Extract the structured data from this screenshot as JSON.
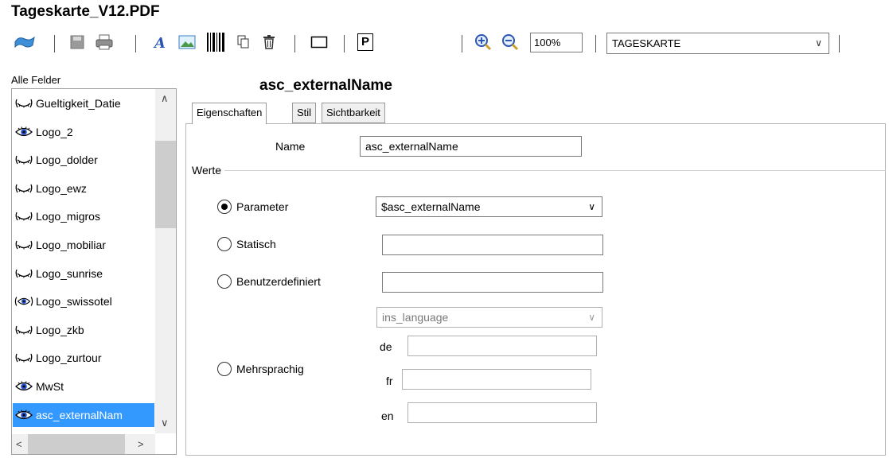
{
  "window": {
    "title": "Tageskarte_V12.PDF"
  },
  "toolbar": {
    "zoom_value": "100%",
    "view_select": "TAGESKARTE",
    "p_label": "P",
    "icons": [
      "back-arrow-icon",
      "save-icon",
      "print-icon",
      "text-field-icon",
      "image-icon",
      "barcode-icon",
      "copy-icon",
      "delete-icon",
      "rectangle-icon",
      "parameter-icon",
      "zoom-in-icon",
      "zoom-out-icon",
      "chevron-down-icon"
    ]
  },
  "sidebar": {
    "label": "Alle Felder",
    "items": [
      {
        "label": "Gueltigkeit_Datie",
        "icon": "hidden-eye-icon"
      },
      {
        "label": "Logo_2",
        "icon": "eye-icon"
      },
      {
        "label": "Logo_dolder",
        "icon": "hidden-eye-icon"
      },
      {
        "label": "Logo_ewz",
        "icon": "hidden-eye-icon"
      },
      {
        "label": "Logo_migros",
        "icon": "hidden-eye-icon"
      },
      {
        "label": "Logo_mobiliar",
        "icon": "hidden-eye-icon"
      },
      {
        "label": "Logo_sunrise",
        "icon": "hidden-eye-icon"
      },
      {
        "label": "Logo_swissotel",
        "icon": "conditional-eye-icon"
      },
      {
        "label": "Logo_zkb",
        "icon": "hidden-eye-icon"
      },
      {
        "label": "Logo_zurtour",
        "icon": "hidden-eye-icon"
      },
      {
        "label": "MwSt",
        "icon": "eye-icon"
      },
      {
        "label": "asc_externalNam",
        "icon": "eye-icon",
        "selected": true
      }
    ]
  },
  "main": {
    "heading": "asc_externalName",
    "tabs": [
      {
        "label": "Eigenschaften",
        "active": true
      },
      {
        "label": "Stil"
      },
      {
        "label": "Sichtbarkeit"
      }
    ],
    "name_label": "Name",
    "name_value": "asc_externalName",
    "group_label": "Werte",
    "options": {
      "parameter": {
        "label": "Parameter",
        "value": "$asc_externalName",
        "checked": true
      },
      "statisch": {
        "label": "Statisch",
        "value": ""
      },
      "benutzer": {
        "label": "Benutzerdefiniert",
        "value": ""
      },
      "mehrsprachig": {
        "label": "Mehrsprachig",
        "select_value": "ins_language",
        "languages": [
          {
            "code": "de",
            "value": ""
          },
          {
            "code": "fr",
            "value": ""
          },
          {
            "code": "en",
            "value": ""
          }
        ]
      }
    }
  },
  "colors": {
    "selection": "#3399ff",
    "icon_blue": "#2255cc"
  }
}
